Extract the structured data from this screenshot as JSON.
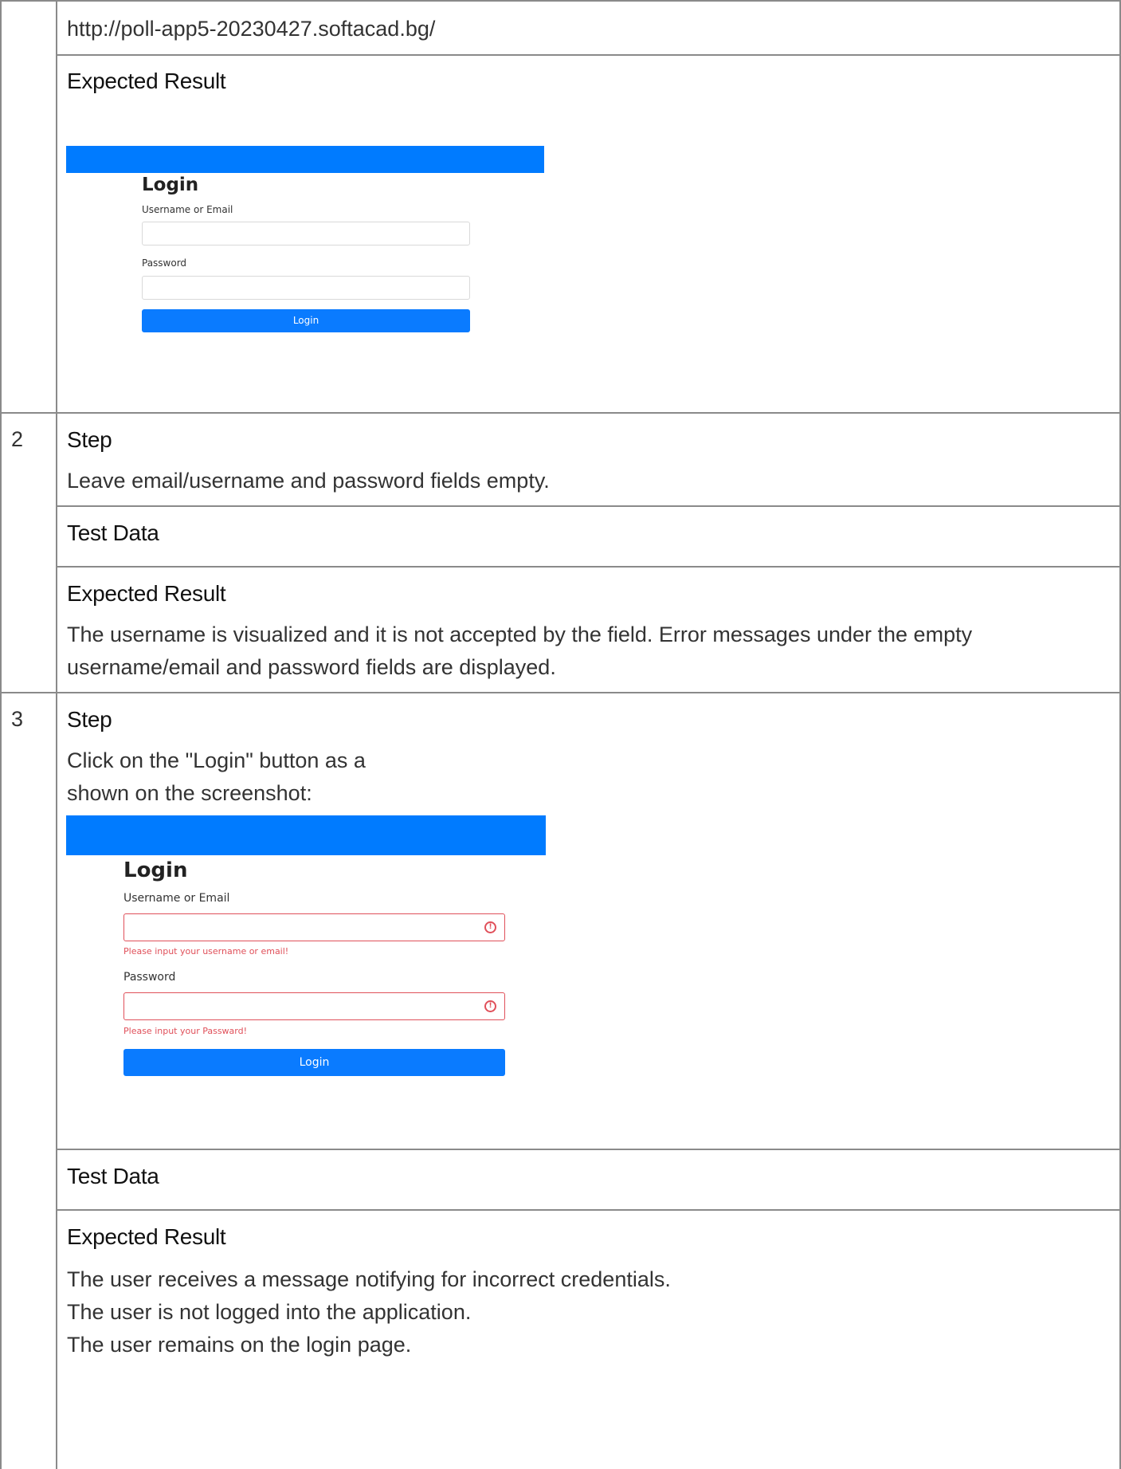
{
  "url_row": {
    "url": "http://poll-app5-20230427.softacad.bg/"
  },
  "row1_expected": {
    "heading": "Expected Result"
  },
  "login_shot_1": {
    "title": "Login",
    "username_label": "Username or Email",
    "password_label": "Password",
    "button_label": "Login",
    "accent_color": "#007bff"
  },
  "step2": {
    "number": "2",
    "step_heading": "Step",
    "step_text": "Leave email/username and password fields empty.",
    "test_data_heading": "Test Data",
    "expected_heading": "Expected Result",
    "expected_line1": "The username is visualized and it is not accepted by the field. Error messages under the empty",
    "expected_line2": "username/email and password fields are displayed."
  },
  "step3": {
    "number": "3",
    "step_heading": "Step",
    "step_line1": "Click on the \"Login\" button as a",
    "step_line2": "shown on the screenshot:",
    "test_data_heading": "Test Data",
    "expected_heading": "Expected Result",
    "expected_lines": [
      "The user receives a message notifying for incorrect credentials.",
      "The user is not logged into the application.",
      "The user remains on the login page."
    ]
  },
  "login_shot_2": {
    "title": "Login",
    "username_label": "Username or Email",
    "username_error": "Please input your username or email!",
    "password_label": "Password",
    "password_error": "Please input your Passward!",
    "button_label": "Login",
    "error_icon_glyph": "!",
    "error_color": "#e0505a",
    "error_icon": "exclamation-circle-icon"
  }
}
